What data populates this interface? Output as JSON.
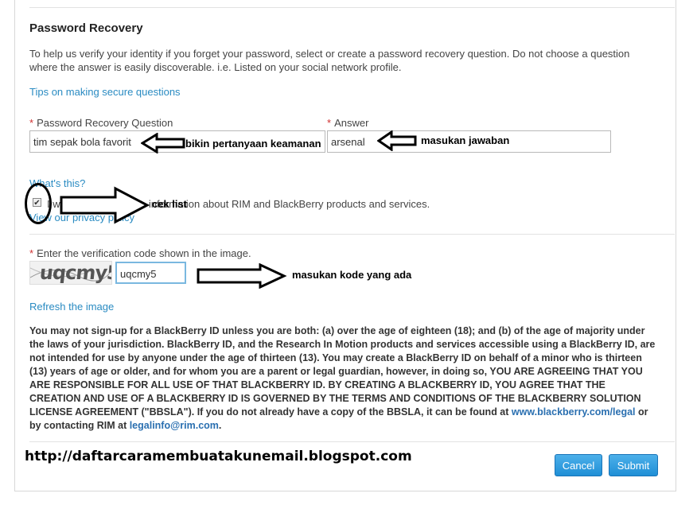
{
  "section": {
    "title": "Password Recovery",
    "description": "To help us verify your identity if you forget your password, select or create a password recovery question. Do not choose a question where the answer is easily discoverable. i.e. Listed on your social network profile.",
    "tips_link": "Tips on making secure questions"
  },
  "question": {
    "required_mark": "*",
    "label": "Password Recovery Question",
    "value": "tim sepak bola favorit"
  },
  "answer": {
    "required_mark": "*",
    "label": "Answer",
    "value": "arsenal"
  },
  "whats_this": "What's this?",
  "opt_in": {
    "checked": true,
    "label": "I would like to receive information about RIM and BlackBerry products and services.",
    "privacy_link": "View our privacy policy"
  },
  "verification": {
    "required_mark": "*",
    "label": "Enter the verification code shown in the image.",
    "captcha_text": "uqcmy5",
    "value": "uqcmy5",
    "refresh_link": "Refresh the image"
  },
  "legal": {
    "text": "You may not sign-up for a BlackBerry ID unless you are both: (a) over the age of eighteen (18); and (b) of the age of majority under the laws of your jurisdiction. BlackBerry ID, and the Research In Motion products and services accessible using a BlackBerry ID, are not intended for use by anyone under the age of thirteen (13). You may create a BlackBerry ID on behalf of a minor who is thirteen (13) years of age or older, and for whom you are a parent or legal guardian, however, in doing so, YOU ARE AGREEING THAT YOU ARE RESPONSIBLE FOR ALL USE OF THAT BLACKBERRY ID. BY CREATING A BLACKBERRY ID, YOU AGREE THAT THE CREATION AND USE OF A BLACKBERRY ID IS GOVERNED BY THE TERMS AND CONDITIONS OF THE BLACKBERRY SOLUTION LICENSE AGREEMENT (\"BBSLA\"). If you do not already have a copy of the BBSLA, it can be found at ",
    "link1": "www.blackberry.com/legal",
    "middle": " or by contacting RIM at ",
    "link2": "legalinfo@rim.com",
    "end": "."
  },
  "annotations": {
    "question_note": "bikin pertanyaan keamanan",
    "answer_note": "masukan jawaban",
    "checkbox_note": "cek list",
    "code_note": "masukan kode yang ada",
    "blog_url": "http://daftarcaramembuatakunemail.blogspot.com"
  },
  "buttons": {
    "cancel": "Cancel",
    "submit": "Submit"
  },
  "colors": {
    "link": "#2a8bc2",
    "button": "#1f8fd6",
    "required": "#d03030"
  }
}
